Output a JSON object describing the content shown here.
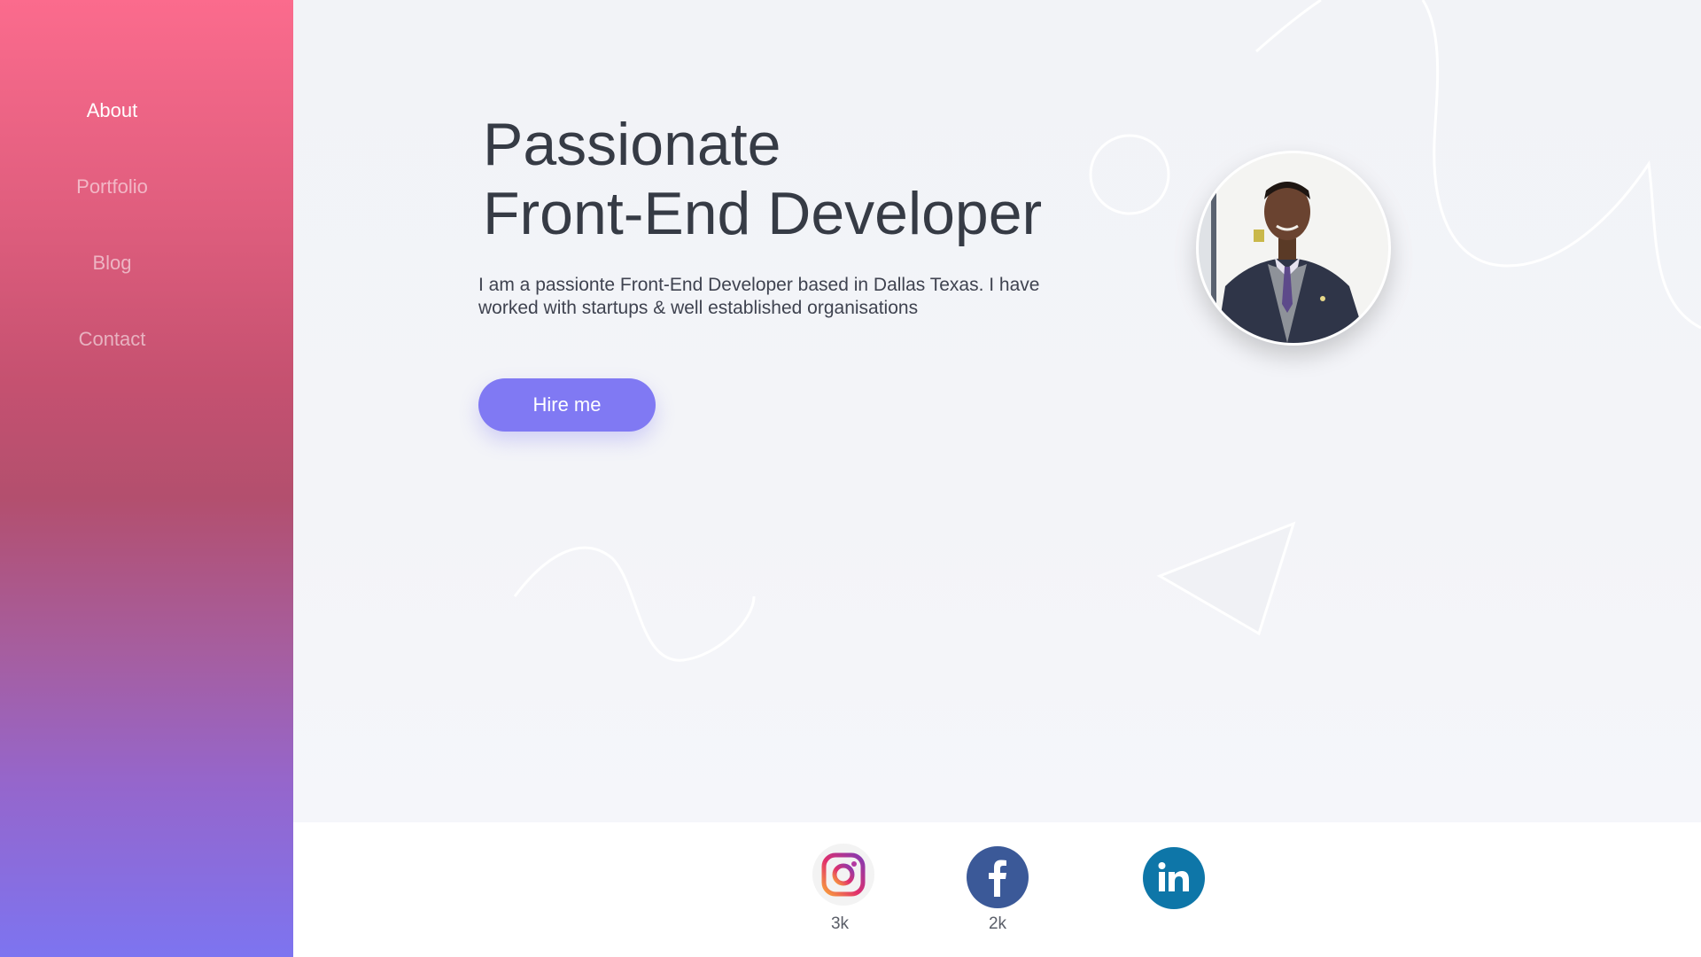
{
  "sidebar": {
    "items": [
      {
        "label": "About"
      },
      {
        "label": "Portfolio"
      },
      {
        "label": "Blog"
      },
      {
        "label": "Contact"
      }
    ],
    "active_item": "About"
  },
  "hero": {
    "title_line1": "Passionate",
    "title_line2": "Front-End Developer",
    "description": "I am a passionte Front-End Developer based in Dallas Texas. I have worked with startups & well established organisations",
    "cta_label": "Hire me"
  },
  "social": [
    {
      "name": "instagram",
      "icon": "instagram-icon",
      "count": "3k"
    },
    {
      "name": "facebook",
      "icon": "facebook-icon",
      "count": "2k"
    },
    {
      "name": "linkedin",
      "icon": "linkedin-icon"
    }
  ],
  "colors": {
    "sidebar_gradient_top": "#fb6b8d",
    "sidebar_gradient_bottom": "#7d74f0",
    "accent": "#8079f3",
    "heading": "#363b45",
    "facebook": "#3b5998",
    "linkedin": "#0e76a8"
  }
}
